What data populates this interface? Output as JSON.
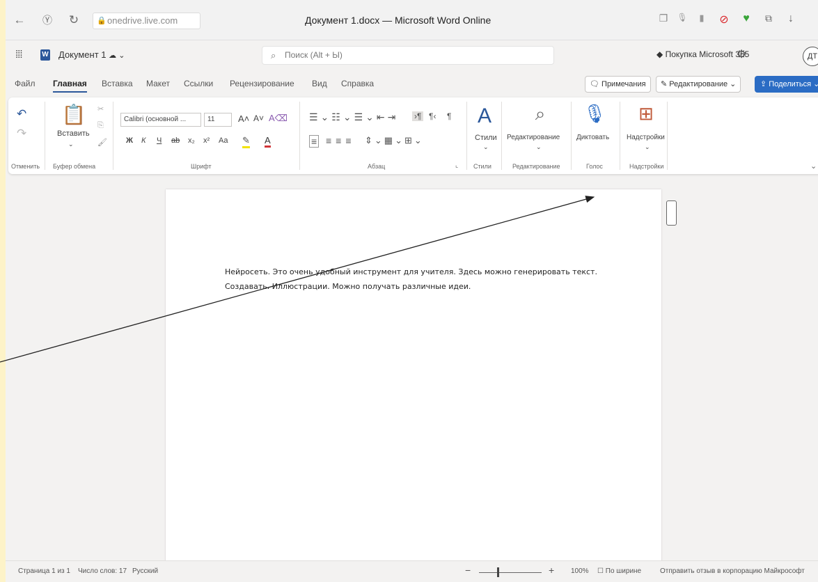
{
  "browser": {
    "url": "onedrive.live.com",
    "title": "Документ 1.docx — Microsoft Word Online",
    "icons": [
      "back-icon",
      "yandex-icon",
      "reload-icon",
      "lock-icon",
      "tab-icon",
      "mic-icon",
      "bookmark-icon",
      "adblock-icon",
      "extension-icon",
      "collections-icon",
      "download-icon"
    ]
  },
  "header": {
    "doc_name": "Документ 1",
    "search_placeholder": "Поиск (Alt + Ы)",
    "buy": "Покупка Microsoft 365",
    "avatar": "ДТ"
  },
  "tabs": [
    "Файл",
    "Главная",
    "Вставка",
    "Макет",
    "Ссылки",
    "Рецензирование",
    "Вид",
    "Справка"
  ],
  "active_tab": "Главная",
  "actions": {
    "comments": "Примечания",
    "editing": "Редактирование",
    "share": "Поделиться"
  },
  "ribbon": {
    "paste": "Вставить",
    "font_name": "Calibri (основной ...",
    "font_size": "11",
    "styles": "Стили",
    "editing": "Редактирование",
    "dictate": "Диктовать",
    "addins": "Надстройки",
    "groups": {
      "undo": "Отменить",
      "clipboard": "Буфер обмена",
      "font": "Шрифт",
      "paragraph": "Абзац",
      "styles": "Стили",
      "editing": "Редактирование",
      "voice": "Голос",
      "addins": "Надстройки"
    },
    "font_buttons": [
      "Ж",
      "К",
      "Ч",
      "ab",
      "x₂",
      "x²",
      "Aa"
    ]
  },
  "document": {
    "lines": [
      "Нейросеть. Это очень удобный инструмент для учителя. Здесь можно генерировать текст.",
      "Создавать. Иллюстрации. Можно получать различные идеи."
    ]
  },
  "status": {
    "page": "Страница 1 из 1",
    "words": "Число слов: 17",
    "language": "Русский",
    "zoom": "100%",
    "fit": "По ширине",
    "feedback": "Отправить отзыв в корпорацию Майкрософт"
  },
  "colors": {
    "accent": "#2b579a",
    "share": "#2b6cc4",
    "frame": "#fdf3c8"
  }
}
